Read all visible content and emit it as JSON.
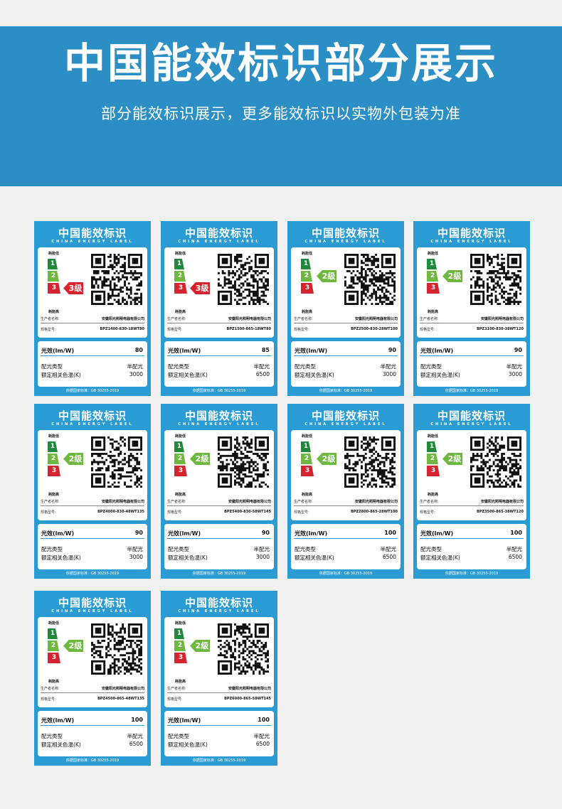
{
  "header": {
    "title": "中国能效标识部分展示",
    "subtitle": "部分能效标识展示，更多能效标识以实物外包装为准"
  },
  "colors": {
    "banner": "#2b8fc5",
    "label_bg": "#2b9bd3",
    "grade1": "#1f8a3a",
    "grade2": "#6fb83f",
    "grade3": "#d6242e"
  },
  "common": {
    "brand_cn": "中国能效标识",
    "brand_en": "CHINA ENERGY LABEL",
    "low": "耗能低",
    "high": "耗能高",
    "g1": "1",
    "g2": "2",
    "g3": "3",
    "maker_key": "生产者名称:",
    "maker_val": "安徽阳光照明电器有限公司",
    "model_key": "规格型号:",
    "eff_key": "光效(lm/W)",
    "type_key": "配光类型",
    "type_val": "半配光",
    "temp_key": "额定相关色温(K)",
    "standard": "依据国家标准：GB 30255-2019"
  },
  "labels": [
    {
      "grade": "3级",
      "grade_level": 3,
      "model": "BPZ1400-830-18WT80",
      "efficacy": "80",
      "temp": "3000"
    },
    {
      "grade": "3级",
      "grade_level": 3,
      "model": "BPZ1500-865-18WT80",
      "efficacy": "85",
      "temp": "6500"
    },
    {
      "grade": "2级",
      "grade_level": 2,
      "model": "BPZ2500-830-28WT100",
      "efficacy": "90",
      "temp": "3000"
    },
    {
      "grade": "2级",
      "grade_level": 2,
      "model": "BPZ3100-830-38WT120",
      "efficacy": "90",
      "temp": "3000"
    },
    {
      "grade": "2级",
      "grade_level": 2,
      "model": "BPZ4000-830-48WT135",
      "efficacy": "90",
      "temp": "3000"
    },
    {
      "grade": "2级",
      "grade_level": 2,
      "model": "BPZ5400-830-58WT145",
      "efficacy": "90",
      "temp": "3000"
    },
    {
      "grade": "2级",
      "grade_level": 2,
      "model": "BPZ2800-865-28WT100",
      "efficacy": "100",
      "temp": "6500"
    },
    {
      "grade": "2级",
      "grade_level": 2,
      "model": "BPZ3500-865-38WT120",
      "efficacy": "100",
      "temp": "6500"
    },
    {
      "grade": "2级",
      "grade_level": 2,
      "model": "BPZ4500-865-48WT135",
      "efficacy": "100",
      "temp": "6500"
    },
    {
      "grade": "2级",
      "grade_level": 2,
      "model": "BPZ6000-865-58WT145",
      "efficacy": "100",
      "temp": "6500"
    }
  ]
}
